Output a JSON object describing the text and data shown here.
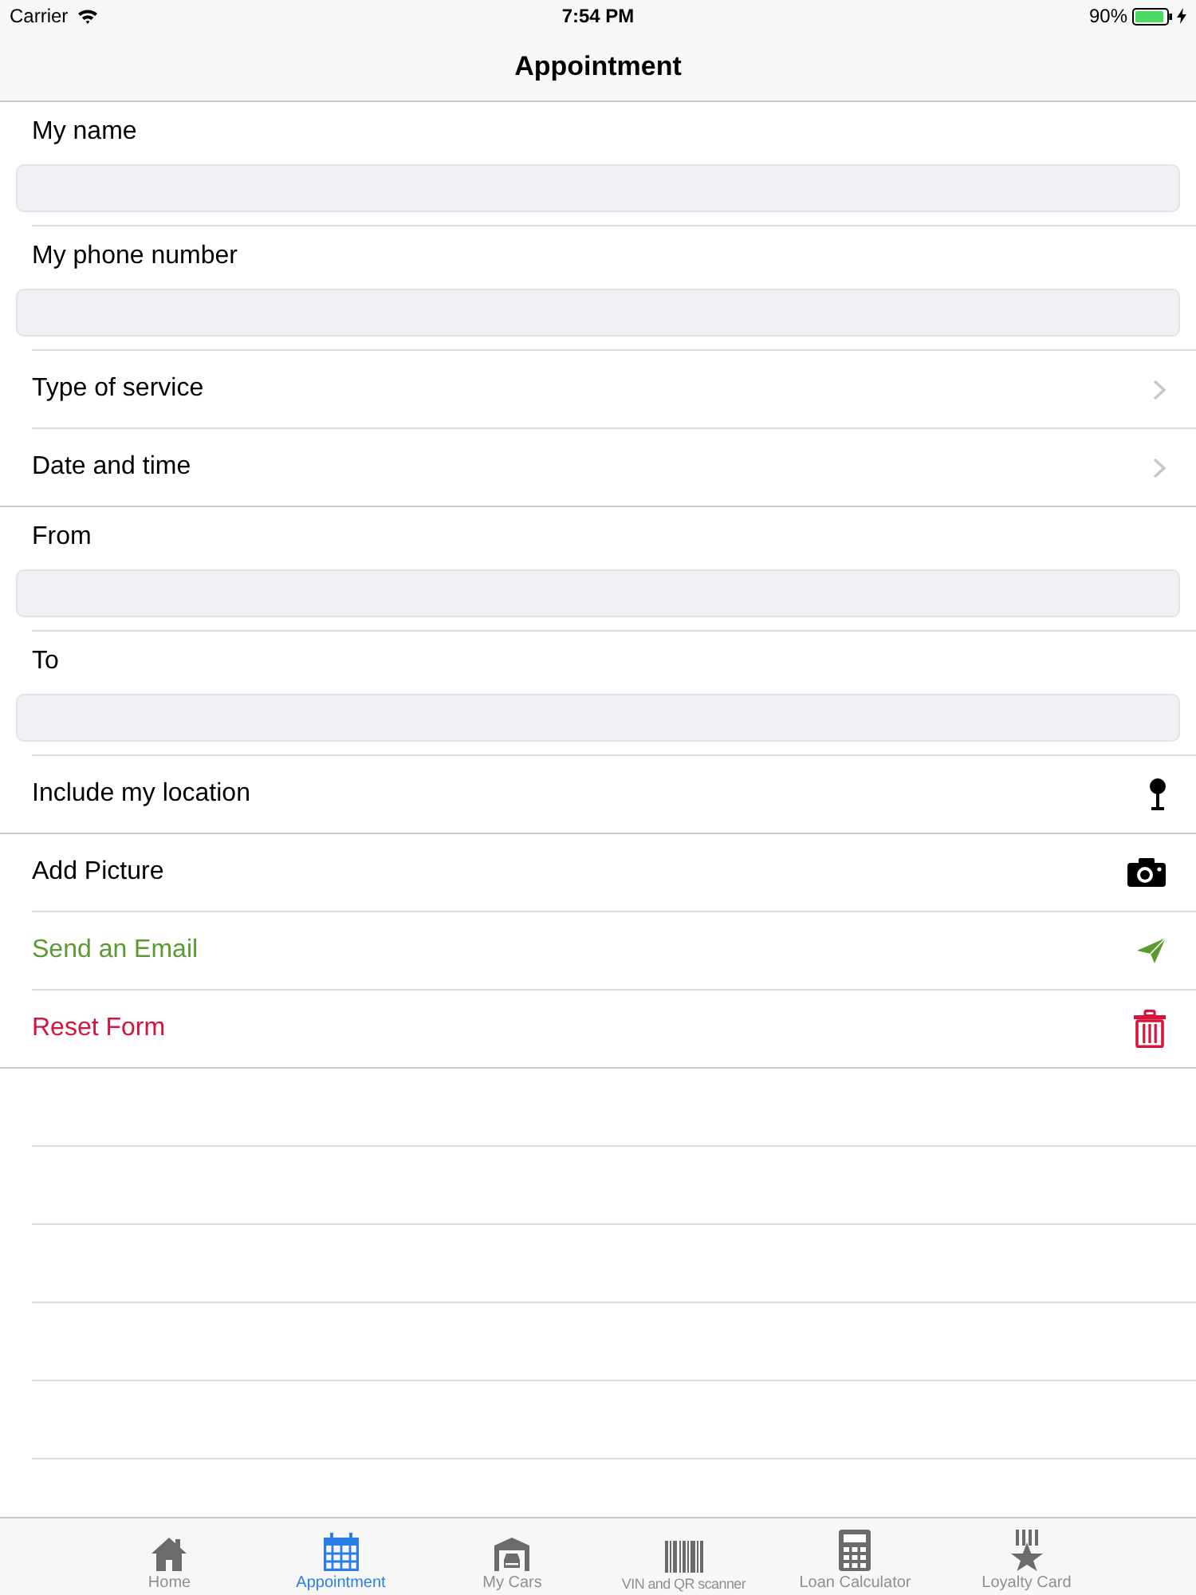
{
  "status_bar": {
    "carrier": "Carrier",
    "time": "7:54 PM",
    "battery": "90%"
  },
  "nav_bar": {
    "title": "Appointment"
  },
  "form": {
    "sections": [
      {
        "rows": [
          {
            "kind": "field",
            "label": "My name"
          },
          {
            "kind": "field",
            "label": "My phone number"
          },
          {
            "kind": "picker",
            "label": "Type of service"
          },
          {
            "kind": "picker",
            "label": "Date and time"
          }
        ]
      },
      {
        "rows": [
          {
            "kind": "field",
            "label": "From"
          },
          {
            "kind": "field",
            "label": "To"
          },
          {
            "kind": "location",
            "label": "Include my location",
            "color": "#000000"
          }
        ]
      },
      {
        "rows": [
          {
            "kind": "photo",
            "label": "Add Picture",
            "color": "#000000"
          },
          {
            "kind": "email",
            "label": "Send an Email",
            "color": "#5a9a32"
          },
          {
            "kind": "reset",
            "label": "Reset Form",
            "color": "#d4143a"
          }
        ]
      }
    ]
  },
  "tab_bar": {
    "tabs": [
      {
        "kind": "home",
        "label": "Home",
        "selected": false
      },
      {
        "kind": "calendar",
        "label": "Appointment",
        "selected": true
      },
      {
        "kind": "garage",
        "label": "My Cars",
        "selected": false
      },
      {
        "kind": "barcode",
        "label": "VIN and QR scanner",
        "selected": false
      },
      {
        "kind": "calculator",
        "label": "Loan Calculator",
        "selected": false
      },
      {
        "kind": "award",
        "label": "Loyalty Card",
        "selected": false
      }
    ]
  }
}
